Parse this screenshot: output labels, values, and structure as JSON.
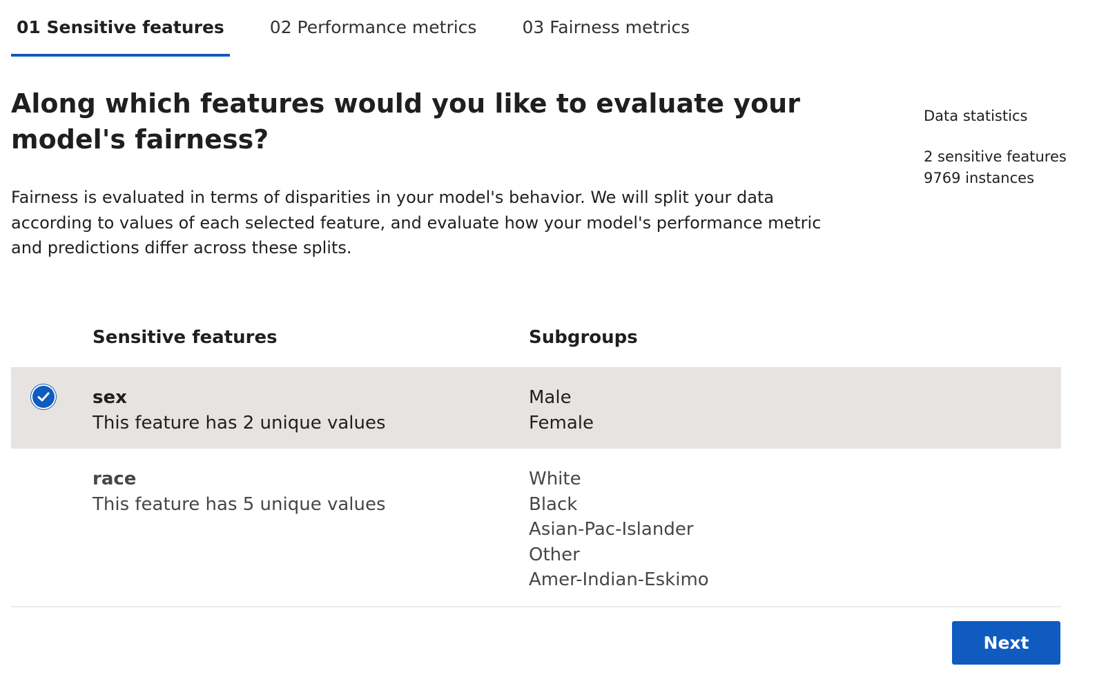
{
  "tabs": [
    {
      "label": "01 Sensitive features",
      "active": true
    },
    {
      "label": "02 Performance metrics",
      "active": false
    },
    {
      "label": "03 Fairness metrics",
      "active": false
    }
  ],
  "main": {
    "title": "Along which features would you like to evaluate your model's fairness?",
    "description": "Fairness is evaluated in terms of disparities in your model's behavior. We will split your data according to values of each selected feature, and evaluate how your model's performance metric and predictions differ across these splits."
  },
  "stats": {
    "title": "Data statistics",
    "features": "2 sensitive features",
    "instances": "9769 instances"
  },
  "table": {
    "headers": {
      "feature": "Sensitive features",
      "subgroups": "Subgroups"
    },
    "rows": [
      {
        "name": "sex",
        "description": "This feature has 2 unique values",
        "selected": true,
        "subgroups": [
          "Male",
          "Female"
        ]
      },
      {
        "name": "race",
        "description": "This feature has 5 unique values",
        "selected": false,
        "subgroups": [
          "White",
          "Black",
          "Asian-Pac-Islander",
          "Other",
          "Amer-Indian-Eskimo"
        ]
      }
    ]
  },
  "footer": {
    "next_label": "Next"
  },
  "icons": {
    "selected_check": "checkmark-circle-icon"
  },
  "colors": {
    "accent": "#0f5bc0",
    "selected_row_bg": "#e6e3e1",
    "text": "#201f1e"
  }
}
